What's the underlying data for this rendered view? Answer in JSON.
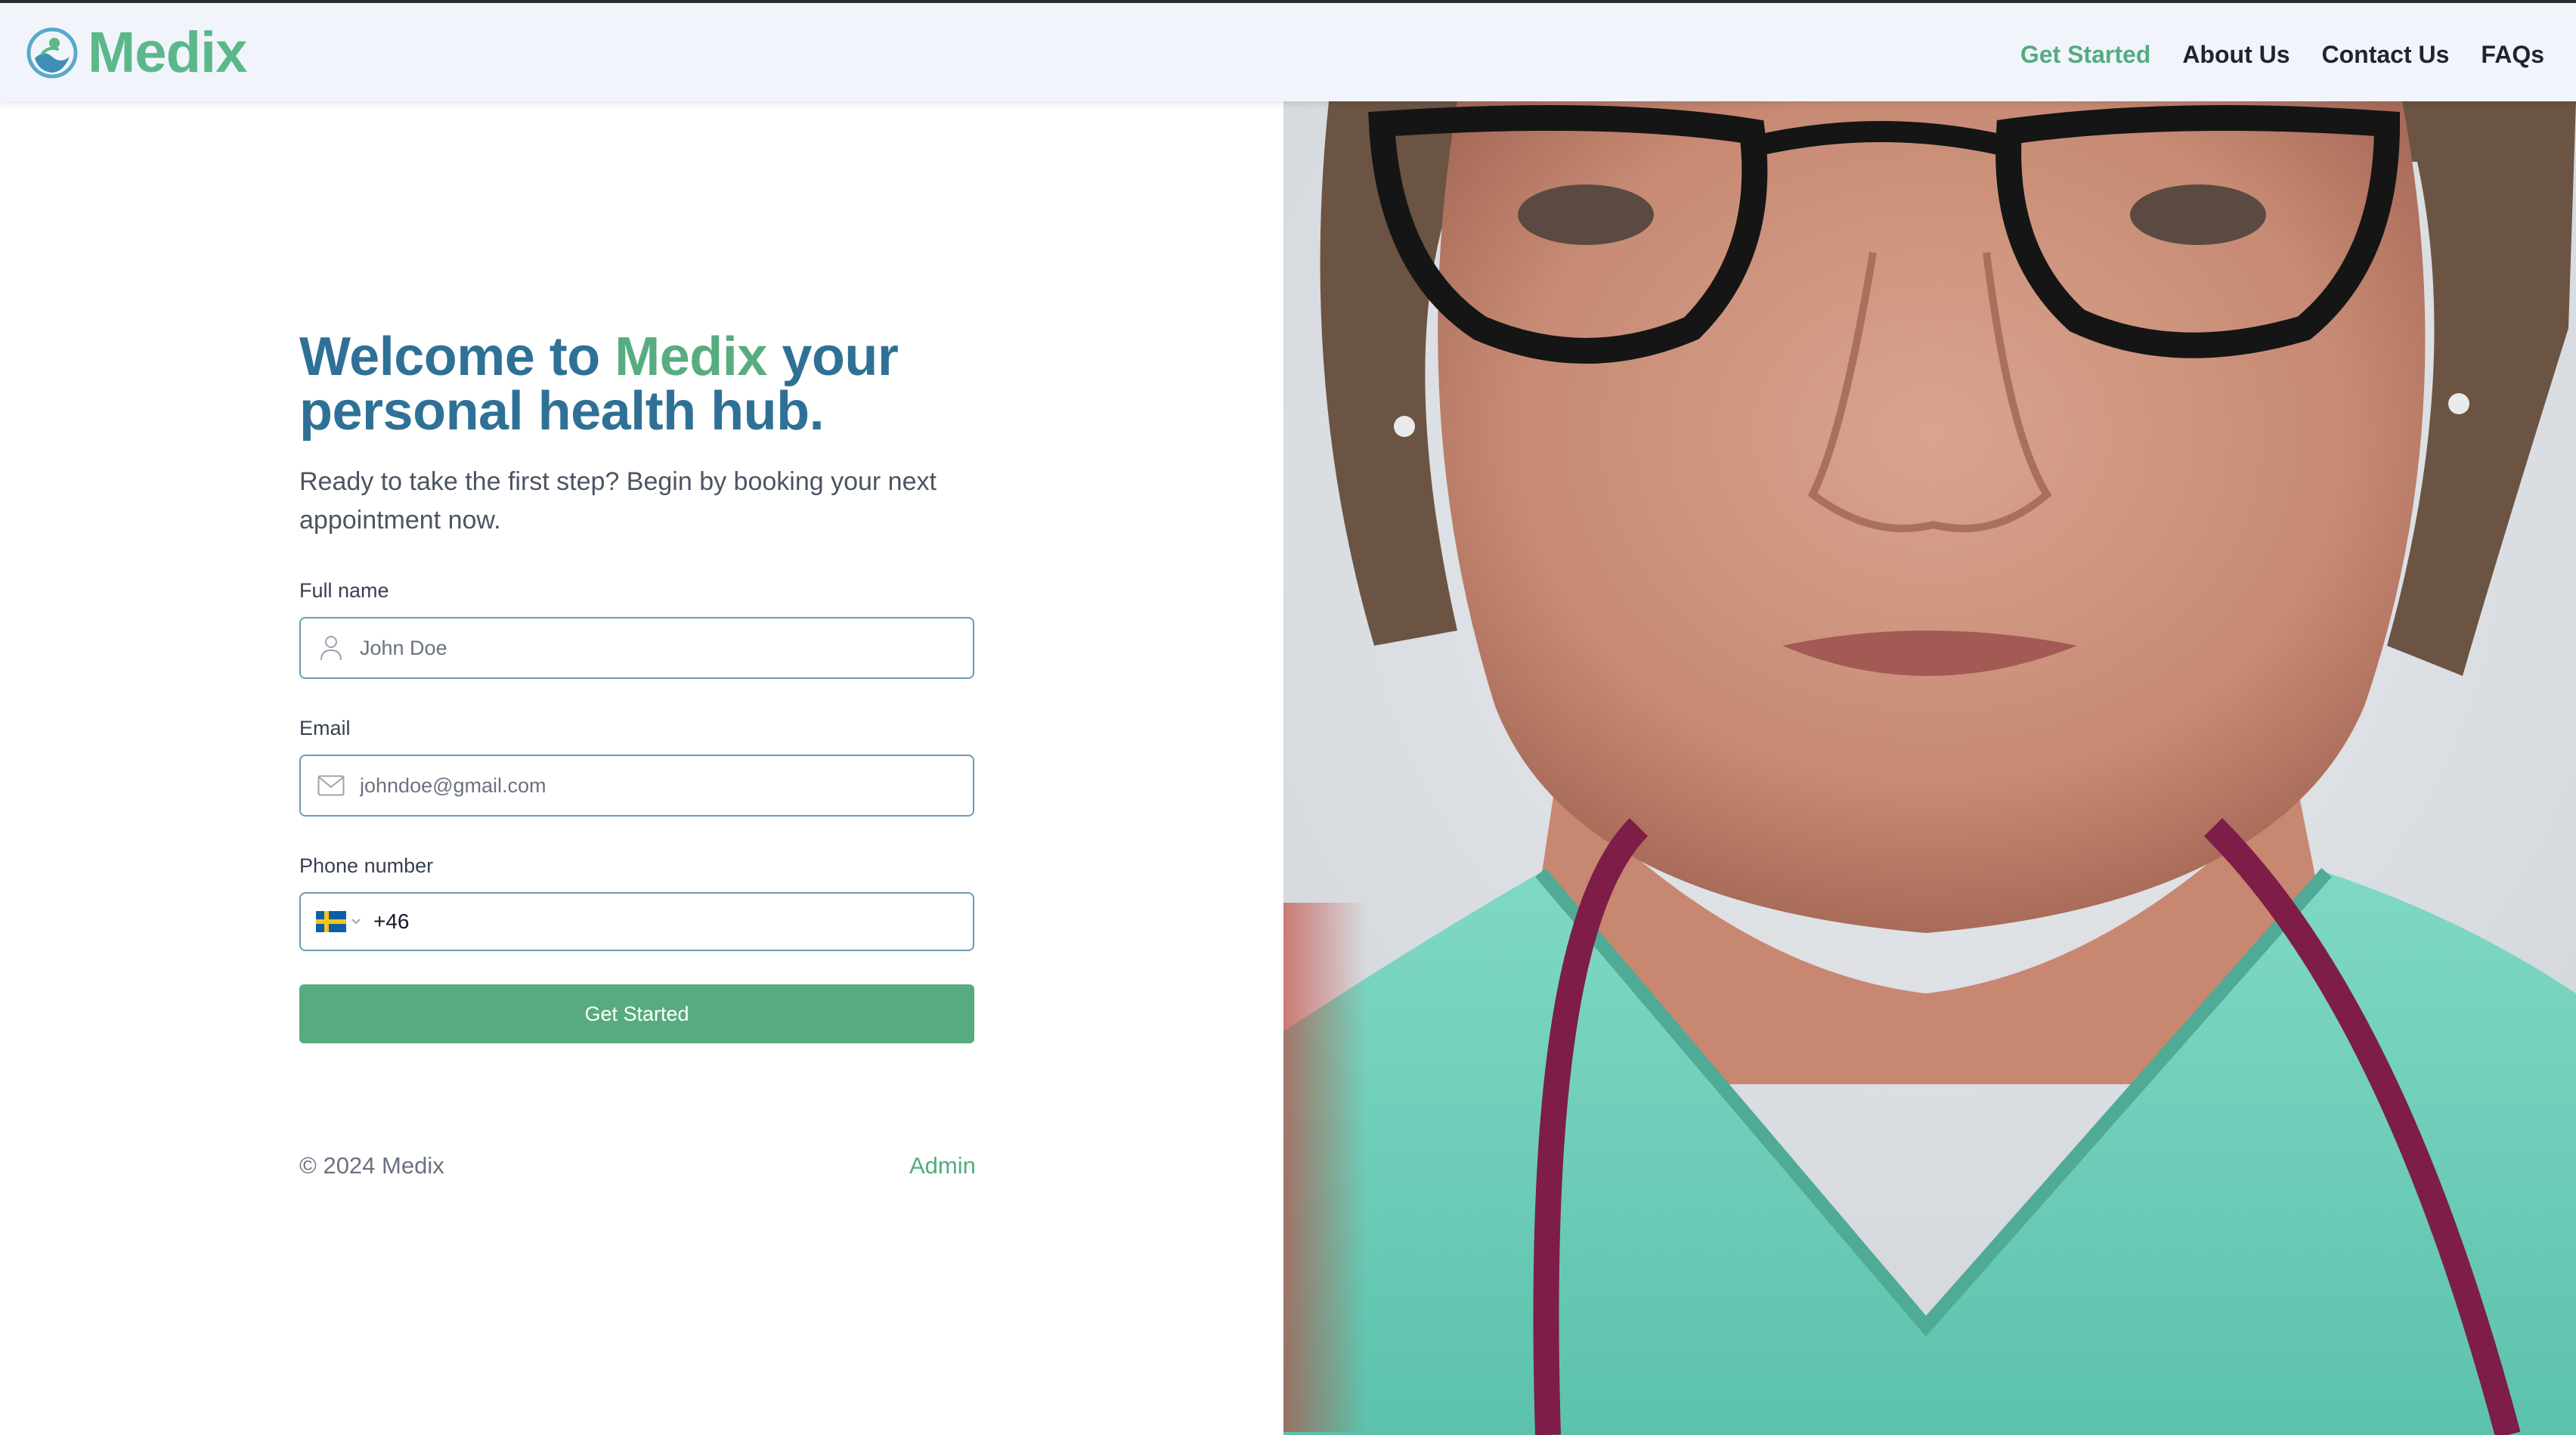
{
  "brand": {
    "name": "Medix",
    "icon": "medix-logo-icon"
  },
  "nav": {
    "items": [
      {
        "label": "Get Started",
        "active": true
      },
      {
        "label": "About Us",
        "active": false
      },
      {
        "label": "Contact Us",
        "active": false
      },
      {
        "label": "FAQs",
        "active": false
      }
    ]
  },
  "hero": {
    "title_part1": "Welcome to ",
    "title_brand": "Medix",
    "title_part2": " your personal health hub.",
    "subtitle": "Ready to take the first step? Begin by booking your next appointment now."
  },
  "form": {
    "full_name": {
      "label": "Full name",
      "placeholder": "John Doe",
      "icon": "user-icon"
    },
    "email": {
      "label": "Email",
      "placeholder": "johndoe@gmail.com",
      "icon": "mail-icon"
    },
    "phone": {
      "label": "Phone number",
      "value": "+46",
      "country_icon": "sweden-flag-icon"
    },
    "submit_label": "Get Started"
  },
  "footer": {
    "copyright": "© 2024 Medix",
    "admin_link": "Admin"
  },
  "colors": {
    "brand_green": "#57ab7e",
    "title_blue": "#2f7196",
    "nav_bg": "#f1f5fb",
    "input_border": "#6b9cb6"
  },
  "photo": {
    "description_icon": "doctor-portrait-image"
  }
}
